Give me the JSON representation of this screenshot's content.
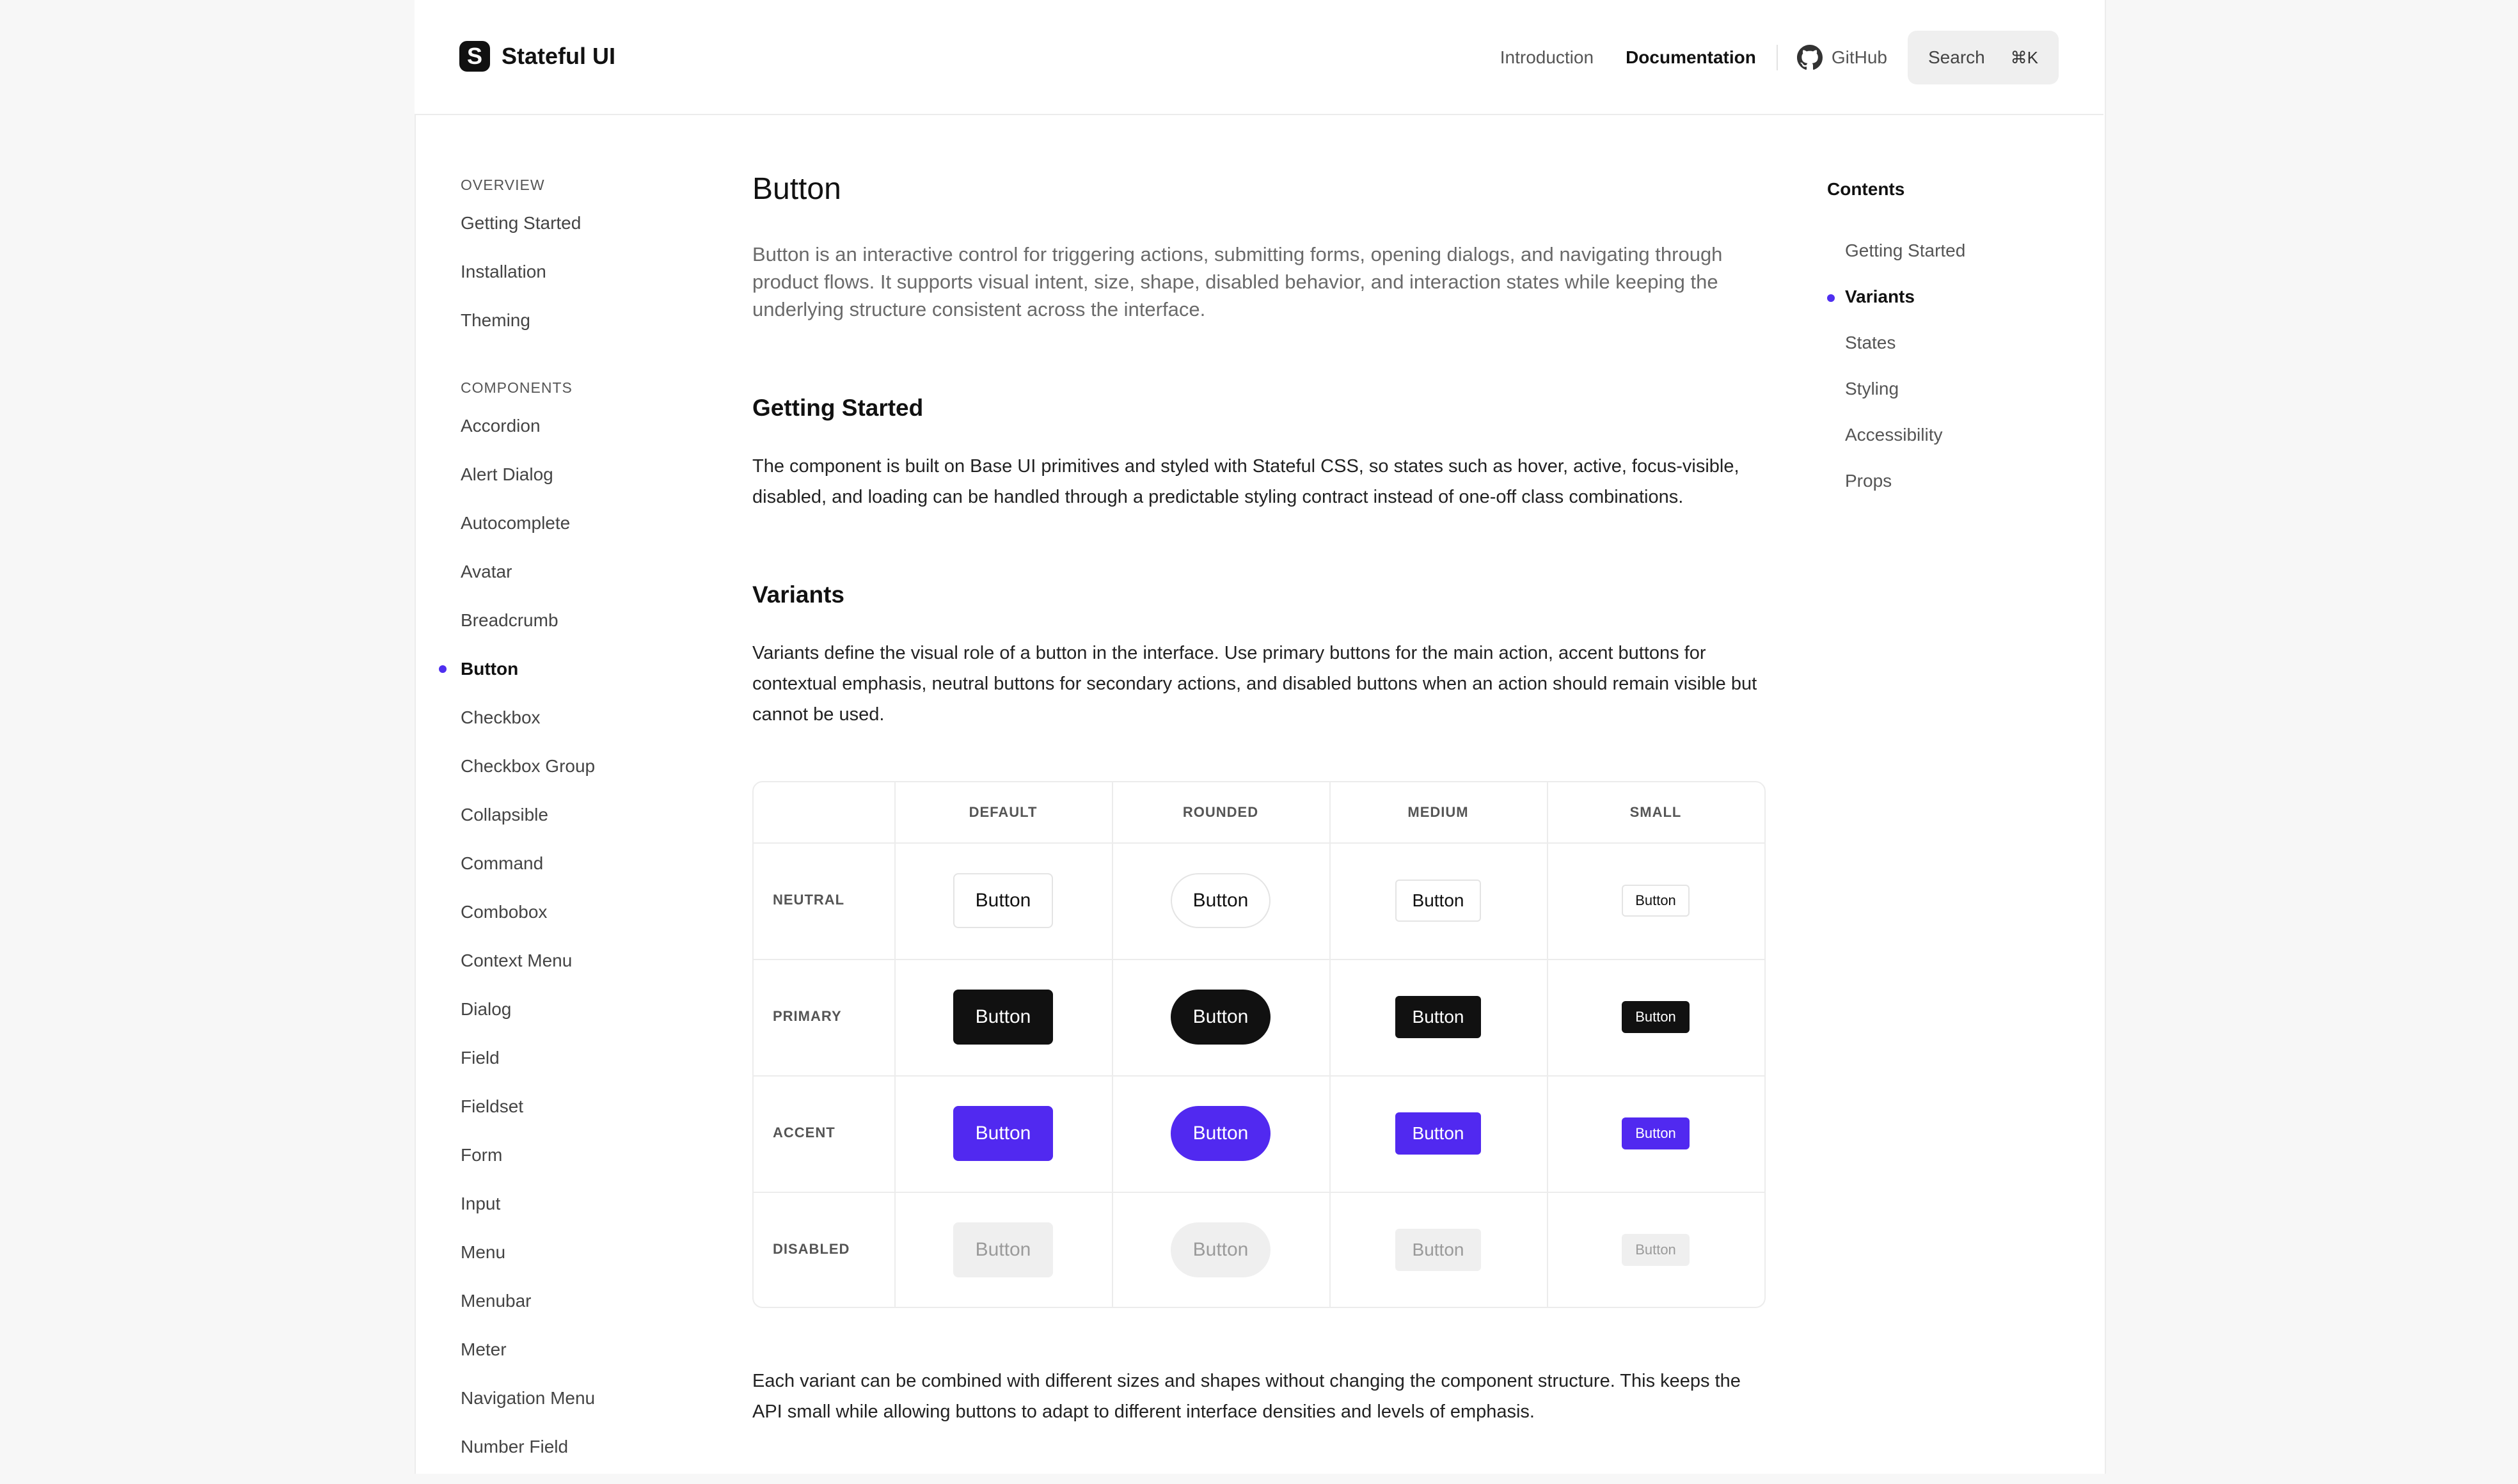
{
  "header": {
    "logo_text": "Stateful UI",
    "nav": {
      "introduction": "Introduction",
      "documentation": "Documentation",
      "github": "GitHub"
    },
    "search": {
      "label": "Search",
      "shortcut": "⌘K"
    }
  },
  "sidebar": {
    "overview_heading": "OVERVIEW",
    "overview_items": [
      "Getting Started",
      "Installation",
      "Theming"
    ],
    "components_heading": "COMPONENTS",
    "component_items": [
      "Accordion",
      "Alert Dialog",
      "Autocomplete",
      "Avatar",
      "Breadcrumb",
      "Button",
      "Checkbox",
      "Checkbox Group",
      "Collapsible",
      "Command",
      "Combobox",
      "Context Menu",
      "Dialog",
      "Field",
      "Fieldset",
      "Form",
      "Input",
      "Menu",
      "Menubar",
      "Meter",
      "Navigation Menu",
      "Number Field"
    ],
    "active_item": "Button"
  },
  "main": {
    "title": "Button",
    "lead": "Button is an interactive control for triggering actions, submitting forms, opening dialogs, and navigating through product flows. It supports visual intent, size, shape, disabled behavior, and interaction states while keeping the underlying structure consistent across the interface.",
    "getting_started": {
      "heading": "Getting Started",
      "text": "The component is built on Base UI primitives and styled with Stateful CSS, so states such as hover, active, focus-visible, disabled, and loading can be handled through a predictable styling contract instead of one-off class combinations."
    },
    "variants": {
      "heading": "Variants",
      "text": "Variants define the visual role of a button in the interface. Use primary buttons for the main action, accent buttons for contextual emphasis, neutral buttons for secondary actions, and disabled buttons when an action should remain visible but cannot be used.",
      "columns": [
        "DEFAULT",
        "ROUNDED",
        "MEDIUM",
        "SMALL"
      ],
      "rows": [
        "NEUTRAL",
        "PRIMARY",
        "ACCENT",
        "DISABLED"
      ],
      "button_label": "Button"
    },
    "closing": "Each variant can be combined with different sizes and shapes without changing the component structure. This keeps the API small while allowing buttons to adapt to different interface densities and levels of emphasis."
  },
  "toc": {
    "title": "Contents",
    "items": [
      "Getting Started",
      "Variants",
      "States",
      "Styling",
      "Accessibility",
      "Props"
    ],
    "active_item": "Variants"
  },
  "colors": {
    "accent": "#5129f0",
    "primary": "#111111",
    "indicator": "#4f2ff0"
  }
}
